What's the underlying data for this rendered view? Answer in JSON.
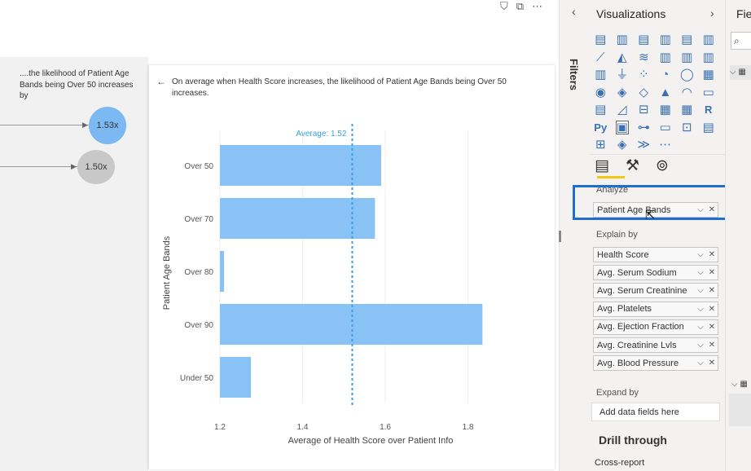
{
  "left_panel": {
    "description": "....the likelihood of Patient Age Bands being Over 50 increases by",
    "bubbles": [
      "1.53x",
      "1.50x"
    ]
  },
  "card": {
    "description": "On average when Health Score increases, the likelihood of Patient Age Bands being Over 50 increases.",
    "back_icon": "arrow-left-icon"
  },
  "chart_data": {
    "type": "bar",
    "orientation": "horizontal",
    "categories": [
      "Over 50",
      "Over 70",
      "Over 80",
      "Over 90",
      "Under 50"
    ],
    "values": [
      1.59,
      1.575,
      1.21,
      1.835,
      1.275
    ],
    "xlim": [
      1.2,
      1.86
    ],
    "xticks": [
      "1.2",
      "1.4",
      "1.6",
      "1.8"
    ],
    "xlabel": "Average of Health Score over Patient Info",
    "ylabel": "Patient Age Bands",
    "reference_line": {
      "label": "Average: 1.52",
      "value": 1.52
    },
    "bar_color": "#89c3f6",
    "reference_color": "#3a9ee4"
  },
  "filters": {
    "label": "Filters",
    "chevron_icon": "chevron-left-icon"
  },
  "visualizations": {
    "title": "Visualizations",
    "chevron_icon": "chevron-right-icon",
    "icons": [
      "stacked-bar-chart-icon",
      "stacked-column-chart-icon",
      "clustered-bar-chart-icon",
      "clustered-column-chart-icon",
      "100-bar-chart-icon",
      "100-column-chart-icon",
      "line-chart-icon",
      "area-chart-icon",
      "stacked-area-chart-icon",
      "line-column-chart-icon",
      "line-clustered-column-icon",
      "ribbon-chart-icon",
      "waterfall-chart-icon",
      "funnel-chart-icon",
      "scatter-chart-icon",
      "pie-chart-icon",
      "donut-chart-icon",
      "treemap-icon",
      "map-icon",
      "filled-map-icon",
      "shape-map-icon",
      "azure-map-icon",
      "gauge-icon",
      "card-icon",
      "multi-row-card-icon",
      "kpi-icon",
      "slicer-icon",
      "table-icon",
      "matrix-icon",
      "r-visual-icon",
      "python-visual-icon",
      "key-influencers-icon",
      "decomposition-tree-icon",
      "qa-icon",
      "smart-narrative-icon",
      "paginated-report-icon",
      "power-apps-icon",
      "power-automate-icon",
      "arcgis-icon",
      "more-icon"
    ],
    "glyphs": [
      "▤",
      "▥",
      "▤",
      "▥",
      "▤",
      "▥",
      "⟋",
      "◭",
      "≋",
      "▥",
      "▥",
      "▥",
      "▥",
      "⏚",
      "⁘",
      "◔",
      "◯",
      "▦",
      "◉",
      "◈",
      "◇",
      "▲",
      "◠",
      "▭",
      "▤",
      "◿",
      "⊟",
      "▦",
      "▦",
      "R",
      "Py",
      "▣",
      "⊶",
      "▭",
      "⊡",
      "▤",
      "⊞",
      "◈",
      "≫",
      "⋯"
    ],
    "selected_index": 31,
    "tabs": [
      "fields-tab-icon",
      "format-paint-icon",
      "analytics-icon"
    ],
    "tab_glyphs": [
      "▤",
      "⚒",
      "⊚"
    ],
    "analyze_label": "Analyze",
    "analyze_field": "Patient Age Bands",
    "explain_label": "Explain by",
    "explain_fields": [
      "Health Score",
      "Avg. Serum Sodium",
      "Avg. Serum Creatinine",
      "Avg. Platelets",
      "Avg. Ejection Fraction",
      "Avg. Creatinine Lvls",
      "Avg. Blood Pressure"
    ],
    "expand_label": "Expand by",
    "expand_placeholder": "Add data fields here",
    "drill_title": "Drill through",
    "cross_report": "Cross-report"
  },
  "fields_pane": {
    "title": "Fie",
    "search_icon": "search-icon"
  },
  "top_icons": [
    "filter-icon",
    "focus-mode-icon",
    "more-options-icon"
  ]
}
